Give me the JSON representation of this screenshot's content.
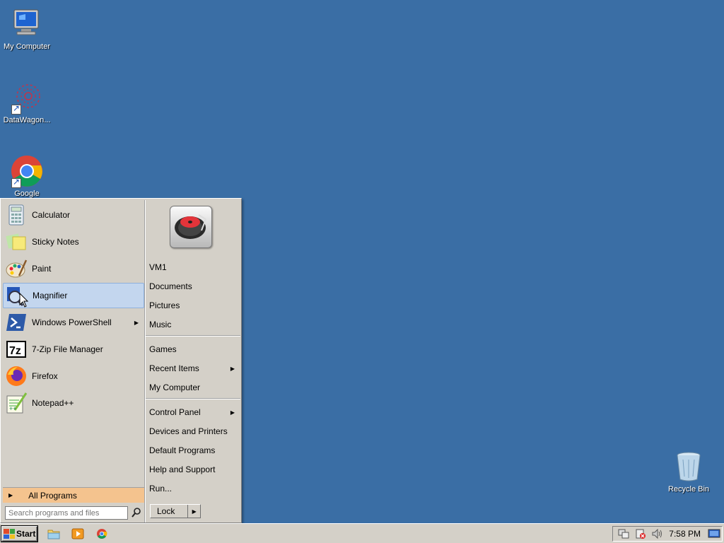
{
  "desktop": {
    "icons": [
      {
        "label": "My Computer",
        "icon": "my-computer-icon"
      },
      {
        "label": "DataWagon...",
        "icon": "datawagon-icon"
      },
      {
        "label": "Google Chrome",
        "icon": "chrome-icon"
      },
      {
        "label": "Recycle Bin",
        "icon": "recycle-bin-icon"
      }
    ]
  },
  "start_menu": {
    "programs": [
      {
        "label": "Calculator",
        "icon": "calculator-icon"
      },
      {
        "label": "Sticky Notes",
        "icon": "sticky-notes-icon"
      },
      {
        "label": "Paint",
        "icon": "paint-icon"
      },
      {
        "label": "Magnifier",
        "icon": "magnifier-icon",
        "highlighted": true
      },
      {
        "label": "Windows PowerShell",
        "icon": "powershell-icon",
        "has_submenu": true
      },
      {
        "label": "7-Zip File Manager",
        "icon": "7zip-icon"
      },
      {
        "label": "Firefox",
        "icon": "firefox-icon"
      },
      {
        "label": "Notepad++",
        "icon": "notepadpp-icon"
      }
    ],
    "all_programs": "All Programs",
    "search": {
      "placeholder": "Search programs and files"
    },
    "places": [
      {
        "label": "VM1"
      },
      {
        "label": "Documents"
      },
      {
        "label": "Pictures"
      },
      {
        "label": "Music"
      },
      {
        "label": "Games"
      },
      {
        "label": "Recent Items",
        "has_submenu": true
      },
      {
        "label": "My Computer"
      },
      {
        "label": "Control Panel",
        "has_submenu": true
      },
      {
        "label": "Devices and Printers"
      },
      {
        "label": "Default Programs"
      },
      {
        "label": "Help and Support"
      },
      {
        "label": "Run..."
      }
    ],
    "lock_label": "Lock"
  },
  "taskbar": {
    "start_label": "Start",
    "quick_launch": [
      "file-explorer-icon",
      "media-player-icon",
      "chrome-icon"
    ],
    "tray_icons": [
      "network-icon",
      "action-center-icon",
      "volume-icon",
      "show-desktop-icon"
    ],
    "clock": "7:58 PM"
  },
  "colors": {
    "desktop": "#3a6ea5",
    "menu": "#d4d0c8",
    "all_programs_bg": "#f4c38e",
    "hover": "#c3d6ee"
  }
}
